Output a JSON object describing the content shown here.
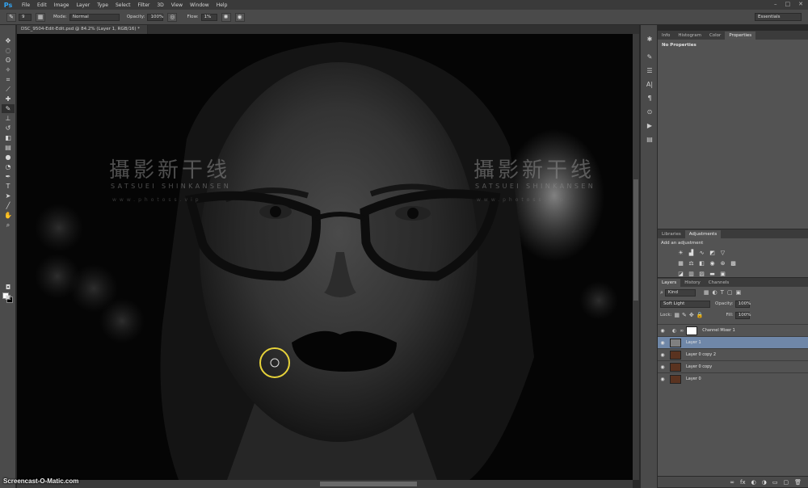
{
  "menubar": {
    "logo": "Ps",
    "items": [
      "File",
      "Edit",
      "Image",
      "Layer",
      "Type",
      "Select",
      "Filter",
      "3D",
      "View",
      "Window",
      "Help"
    ],
    "window_controls": [
      "–",
      "□",
      "✕"
    ]
  },
  "options": {
    "brush_size": "9",
    "mode_label": "Mode:",
    "mode_value": "Normal",
    "opacity_label": "Opacity:",
    "opacity_value": "100%",
    "flow_label": "Flow:",
    "flow_value": "1%",
    "workspace": "Essentials"
  },
  "document": {
    "tab_title": "DSC_9504-Edit-Edit.psd @ 84.2% (Layer 1, RGB/16) *",
    "close": "×"
  },
  "watermark": {
    "cn": "攝影新干线",
    "en": "SATSUEI SHINKANSEN",
    "url": "www.photoss.vip"
  },
  "credit": "Screencast-O-Matic.com",
  "panels": {
    "properties": {
      "tabs": [
        "Info",
        "Histogram",
        "Color",
        "Properties"
      ],
      "active_tab": 3,
      "content": "No Properties"
    },
    "adjustments": {
      "tabs": [
        "Libraries",
        "Adjustments"
      ],
      "active_tab": 1,
      "title": "Add an adjustment"
    },
    "layers": {
      "tabs": [
        "Layers",
        "History",
        "Channels"
      ],
      "active_tab": 0,
      "filter_kind": "Kind",
      "blend_mode": "Soft Light",
      "opacity_label": "Opacity:",
      "opacity_value": "100%",
      "lock_label": "Lock:",
      "fill_label": "Fill:",
      "fill_value": "100%",
      "items": [
        {
          "name": "Channel Mixer 1",
          "selected": false
        },
        {
          "name": "Layer 1",
          "selected": true
        },
        {
          "name": "Layer 0 copy 2",
          "selected": false
        },
        {
          "name": "Layer 0 copy",
          "selected": false
        },
        {
          "name": "Layer 0",
          "selected": false
        }
      ],
      "footer_icons": [
        "∞",
        "fx",
        "◐",
        "◑",
        "▭",
        "▢",
        "🗑"
      ]
    }
  },
  "colors": {
    "ps_blue": "#32a4f2",
    "selection": "#6f87a8",
    "brush_cursor": "#e6d23a"
  }
}
